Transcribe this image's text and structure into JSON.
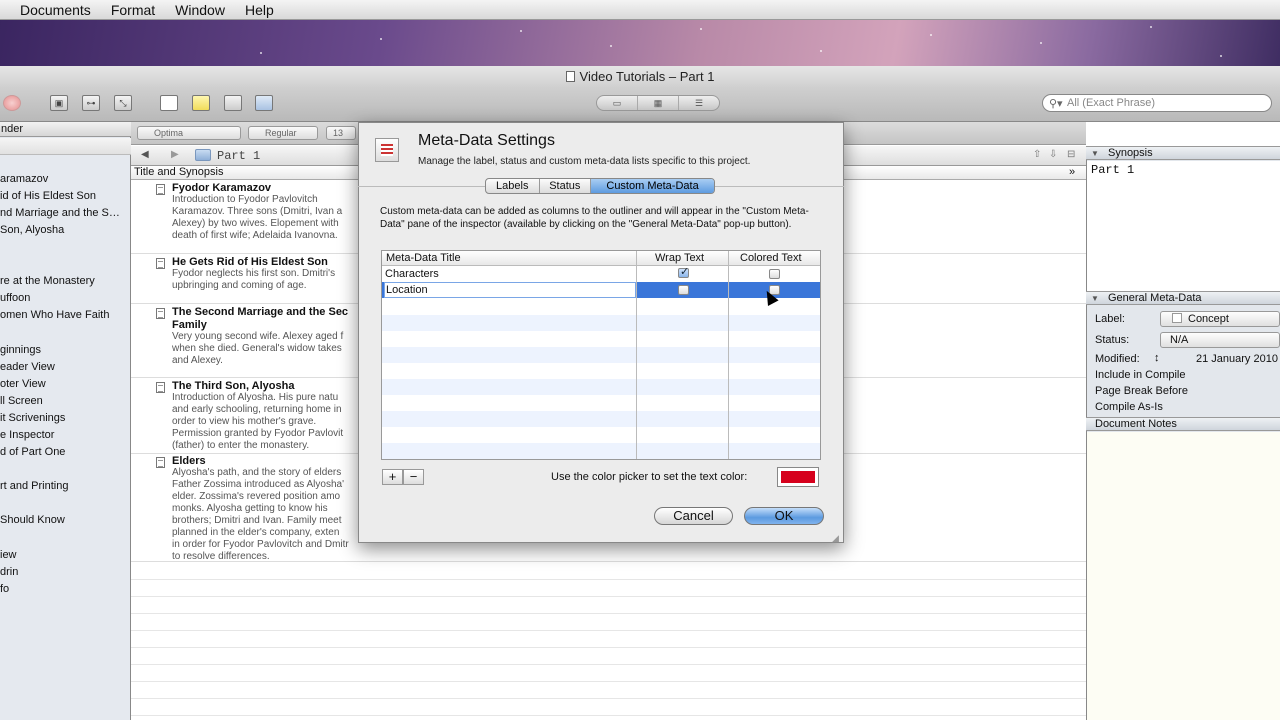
{
  "menubar": {
    "items": [
      "Documents",
      "Format",
      "Window",
      "Help"
    ]
  },
  "window": {
    "title": "Video Tutorials – Part 1"
  },
  "search": {
    "placeholder": "All (Exact Phrase)"
  },
  "binder": {
    "header": "nder",
    "items": [
      "aramazov",
      "id of His Eldest Son",
      "nd Marriage and the S…",
      " Son, Alyosha",
      "re at the Monastery",
      "uffoon",
      "omen Who Have Faith",
      "ginnings",
      "eader View",
      "oter View",
      "ll Screen",
      "it Scrivenings",
      "e Inspector",
      "d of Part One",
      "rt and Printing",
      "Should Know",
      "iew",
      "drin",
      "fo"
    ]
  },
  "formatbar": {
    "font": "Optima",
    "style": "Regular",
    "size": "13"
  },
  "editor": {
    "path": "Part 1",
    "column_header": "Title and Synopsis"
  },
  "outline": [
    {
      "title": "Fyodor Karamazov",
      "synopsis": "Introduction to Fyodor Pavlovitch\nKaramazov. Three sons (Dmitri, Ivan a\nAlexey) by two wives. Elopement with\ndeath of first wife; Adelaida Ivanovna."
    },
    {
      "title": "He Gets Rid of His Eldest Son",
      "synopsis": "Fyodor neglects his first son. Dmitri's\nupbringing and coming of age."
    },
    {
      "title": "The Second Marriage and the Sec",
      "title2": "Family",
      "synopsis": "Very young second wife. Alexey aged f\nwhen she died. General's widow takes\nand Alexey."
    },
    {
      "title": "The Third Son, Alyosha",
      "synopsis": "Introduction of Alyosha. His pure natu\nand early schooling, returning home in\norder to view his mother's grave.\nPermission granted by Fyodor Pavlovit\n(father) to enter the monastery."
    },
    {
      "title": "Elders",
      "synopsis": "Alyosha's path, and the story of elders\nFather Zossima introduced as Alyosha'\nelder. Zossima's revered position amo\nmonks. Alyosha getting to know his\nbrothers; Dmitri and Ivan. Family meet\nplanned in the elder's company, exten\nin order for Fyodor Pavlovitch and Dmitr\nto resolve differences."
    }
  ],
  "inspector": {
    "synopsis_header": "Synopsis",
    "synopsis_text": "Part 1",
    "general_header": "General Meta-Data",
    "label_label": "Label:",
    "label_value": "Concept",
    "status_label": "Status:",
    "status_value": "N/A",
    "modified_label": "Modified:",
    "modified_value": "21 January 2010",
    "include_compile": "Include in Compile",
    "page_break": "Page Break Before",
    "compile_as_is": "Compile As-Is",
    "notes_header": "Document Notes"
  },
  "dialog": {
    "title": "Meta-Data Settings",
    "subtitle": "Manage the label, status and custom meta-data lists specific to this project.",
    "tabs": [
      "Labels",
      "Status",
      "Custom Meta-Data"
    ],
    "selected_tab": "Custom Meta-Data",
    "description": "Custom meta-data can be added as columns to the outliner and will appear in the \"Custom Meta-Data\" pane of the inspector (available by clicking on the \"General Meta-Data\" pop-up button).",
    "table_headers": [
      "Meta-Data Title",
      "Wrap Text",
      "Colored Text"
    ],
    "rows": [
      {
        "title": "Characters",
        "wrap_text": true,
        "colored_text": false
      },
      {
        "title": "Location",
        "wrap_text": false,
        "colored_text": false
      }
    ],
    "add_label": "+",
    "remove_label": "−",
    "color_label": "Use the color picker to set the text color:",
    "text_color": "#d6001c",
    "cancel_label": "Cancel",
    "ok_label": "OK"
  },
  "colors": {
    "selection": "#3a76d9",
    "accent": "#5c9ae0"
  }
}
